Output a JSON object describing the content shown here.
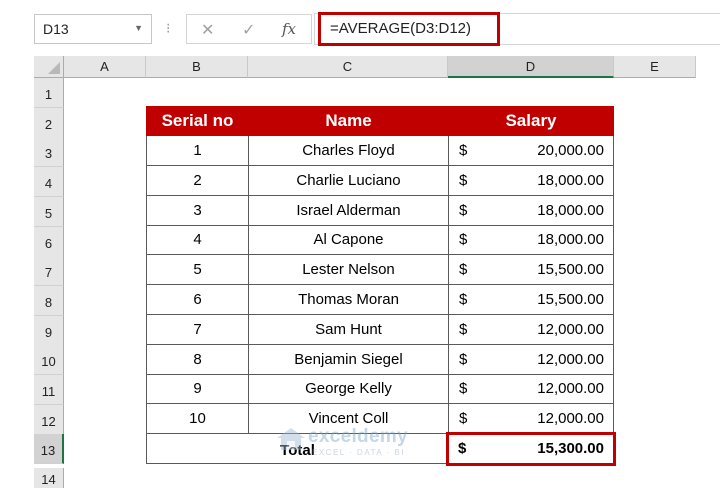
{
  "formula_bar": {
    "name_box": "D13",
    "formula": "=AVERAGE(D3:D12)"
  },
  "columns": [
    "A",
    "B",
    "C",
    "D",
    "E"
  ],
  "rows": [
    "1",
    "2",
    "3",
    "4",
    "5",
    "6",
    "7",
    "8",
    "9",
    "10",
    "11",
    "12",
    "13",
    "14"
  ],
  "table": {
    "headers": [
      "Serial no",
      "Name",
      "Salary"
    ],
    "currency_symbol": "$",
    "rows": [
      {
        "serial": "1",
        "name": "Charles Floyd",
        "salary": "20,000.00"
      },
      {
        "serial": "2",
        "name": "Charlie Luciano",
        "salary": "18,000.00"
      },
      {
        "serial": "3",
        "name": "Israel Alderman",
        "salary": "18,000.00"
      },
      {
        "serial": "4",
        "name": "Al Capone",
        "salary": "18,000.00"
      },
      {
        "serial": "5",
        "name": "Lester Nelson",
        "salary": "15,500.00"
      },
      {
        "serial": "6",
        "name": "Thomas Moran",
        "salary": "15,500.00"
      },
      {
        "serial": "7",
        "name": "Sam Hunt",
        "salary": "12,000.00"
      },
      {
        "serial": "8",
        "name": "Benjamin Siegel",
        "salary": "12,000.00"
      },
      {
        "serial": "9",
        "name": "George Kelly",
        "salary": "12,000.00"
      },
      {
        "serial": "10",
        "name": "Vincent Coll",
        "salary": "12,000.00"
      }
    ],
    "total_label": "Total",
    "total_value": "15,300.00"
  },
  "watermark": {
    "name": "exceldemy",
    "tagline": "EXCEL · DATA · BI"
  },
  "colors": {
    "header_bg": "#c00000",
    "highlight": "#c00000",
    "selected": "#217346"
  }
}
